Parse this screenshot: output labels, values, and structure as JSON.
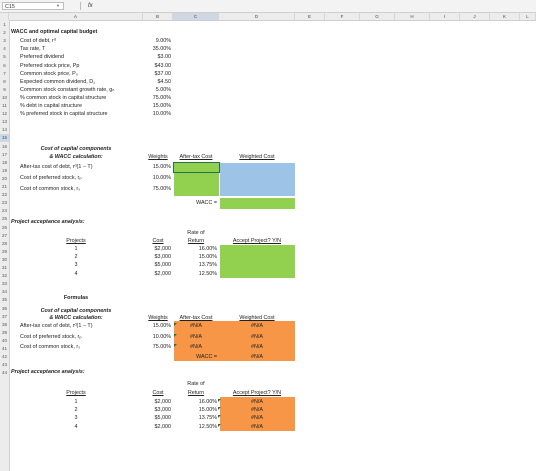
{
  "formula_bar": {
    "name_box": "C15",
    "fx": "fx",
    "formula": ""
  },
  "columns": [
    "A",
    "B",
    "C",
    "D",
    "E",
    "F",
    "G",
    "H",
    "I",
    "J",
    "K",
    "L"
  ],
  "selected_column": "C",
  "rows": [
    "1",
    "2",
    "3",
    "4",
    "5",
    "6",
    "7",
    "8",
    "9",
    "10",
    "11",
    "12",
    "13",
    "14",
    "15",
    "16",
    "17",
    "18",
    "19",
    "20",
    "21",
    "22",
    "23",
    "24",
    "25",
    "26",
    "27",
    "28",
    "29",
    "30",
    "31",
    "32",
    "33",
    "34",
    "35",
    "36",
    "37",
    "38",
    "39",
    "40",
    "41",
    "42",
    "43",
    "44"
  ],
  "selected_row": "15",
  "title": "WACC and optimal capital budget",
  "inputs": [
    {
      "label": "Cost of debt, rᵈ",
      "value": "9.00%"
    },
    {
      "label": "Tax rate, T",
      "value": "35.00%"
    },
    {
      "label": "Preferred dividend",
      "value": "$3.00"
    },
    {
      "label": "Preferred stock price, Pp",
      "value": "$43.00"
    },
    {
      "label": "Common stock price, P₀",
      "value": "$37.00"
    },
    {
      "label": "Expected common dividend, D₁",
      "value": "$4.50"
    },
    {
      "label": "Common stock constant growth rate, gₙ",
      "value": "5.00%"
    },
    {
      "label": "% common stock in capital structure",
      "value": "75.00%"
    },
    {
      "label": "% debt in capital structure",
      "value": "15.00%"
    },
    {
      "label": "% preferred stock in capital structure",
      "value": "10.00%"
    }
  ],
  "section1": {
    "heading_line1": "Cost of capital components",
    "heading_line2": "& WACC calculation:",
    "col_weights": "Weights",
    "col_aftertax": "After-tax Cost",
    "col_weighted": "Weighted Cost",
    "rows": [
      {
        "label": "After-tax cost of debt, rᵈ(1 − T)",
        "weight": "15.00%"
      },
      {
        "label": "Cost of preferred stock, rₚ",
        "weight": "10.00%"
      },
      {
        "label": "Cost of common stock, rₛ",
        "weight": "75.00%"
      }
    ],
    "wacc_label": "WACC ="
  },
  "section2": {
    "heading": "Project acceptance analysis:",
    "col_projects": "Projects",
    "col_cost": "Cost",
    "col_rate_line1": "Rate of",
    "col_rate_line2": "Return",
    "col_accept": "Accept Project? Y/N",
    "projects": [
      {
        "id": "1",
        "cost": "$2,000",
        "rate": "16.00%"
      },
      {
        "id": "2",
        "cost": "$3,000",
        "rate": "15.00%"
      },
      {
        "id": "3",
        "cost": "$5,000",
        "rate": "13.75%"
      },
      {
        "id": "4",
        "cost": "$2,000",
        "rate": "12.50%"
      }
    ]
  },
  "formulas_heading": "Formulas",
  "section3": {
    "heading_line1": "Cost of capital components",
    "heading_line2": "& WACC calculation:",
    "col_weights": "Weights",
    "col_aftertax": "After-tax Cost",
    "col_weighted": "Weighted Cost",
    "rows": [
      {
        "label": "After-tax cost of debt, rᵈ(1 − T)",
        "weight": "15.00%",
        "aftertax": "#N/A",
        "weighted": "#N/A"
      },
      {
        "label": "Cost of preferred stock, rₚ",
        "weight": "10.00%",
        "aftertax": "#N/A",
        "weighted": "#N/A"
      },
      {
        "label": "Cost of common stock, rₛ",
        "weight": "75.00%",
        "aftertax": "#N/A",
        "weighted": "#N/A"
      }
    ],
    "wacc_label": "WACC =",
    "wacc_value": "#N/A"
  },
  "section4": {
    "heading": "Project acceptance analysis:",
    "col_projects": "Projects",
    "col_cost": "Cost",
    "col_rate_line1": "Rate of",
    "col_rate_line2": "Return",
    "col_accept": "Accept Project? Y/N",
    "projects": [
      {
        "id": "1",
        "cost": "$2,000",
        "rate": "16.00%",
        "accept": "#N/A"
      },
      {
        "id": "2",
        "cost": "$3,000",
        "rate": "15.00%",
        "accept": "#N/A"
      },
      {
        "id": "3",
        "cost": "$5,000",
        "rate": "13.75%",
        "accept": "#N/A"
      },
      {
        "id": "4",
        "cost": "$2,000",
        "rate": "12.50%",
        "accept": "#N/A"
      }
    ]
  },
  "colors": {
    "green": "#92d050",
    "blue": "#9dc3e6",
    "orange": "#f79646",
    "selection": "#217346"
  }
}
